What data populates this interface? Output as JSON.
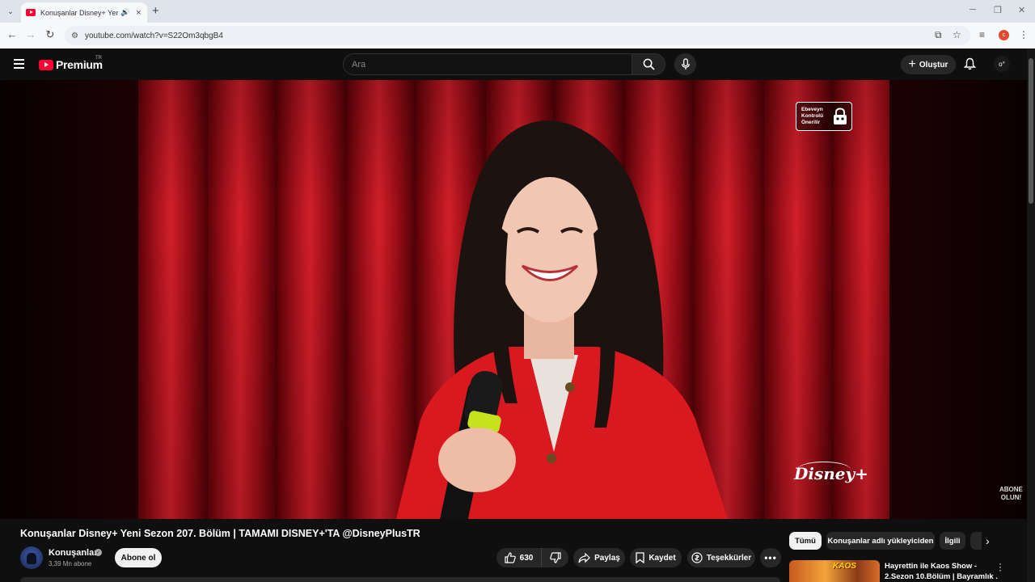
{
  "browser": {
    "tab_title": "Konuşanlar Disney+ Yeni Sezon 207. Bölüm | TAMAMI DISNEY+'TA",
    "url": "youtube.com/watch?v=S22Om3qbgB4",
    "profile_initial": "c"
  },
  "masthead": {
    "logo_text": "Premium",
    "country_code": "TR",
    "search_placeholder": "Ara",
    "create_label": "Oluştur"
  },
  "player": {
    "parental_badge": "Ebeveyn Kontrolü Önerilir",
    "watermark_logo": "Disney+",
    "overlay_line1": "ABONE",
    "overlay_line2": "OLUN!"
  },
  "video": {
    "title": "Konuşanlar Disney+ Yeni Sezon 207. Bölüm | TAMAMI DISNEY+'TA @DisneyPlusTR",
    "channel_name": "Konuşanlar",
    "subscribers": "3,39 Mn abone",
    "subscribe_label": "Abone ol",
    "like_count": "630",
    "share_label": "Paylaş",
    "save_label": "Kaydet",
    "thanks_label": "Teşekkürler"
  },
  "sidebar": {
    "chips": [
      "Tümü",
      "Konuşanlar adlı yükleyiciden",
      "İlgili"
    ],
    "rec_thumb_text": "KAOS",
    "rec_title_line1": "Hayrettin ile Kaos Show -",
    "rec_title_line2": "2.Sezon 10.Bölüm | Bayramlık ..."
  },
  "colors": {
    "youtube_red": "#ff0033",
    "background": "#0f0f0f",
    "pill_bg": "#272727"
  }
}
